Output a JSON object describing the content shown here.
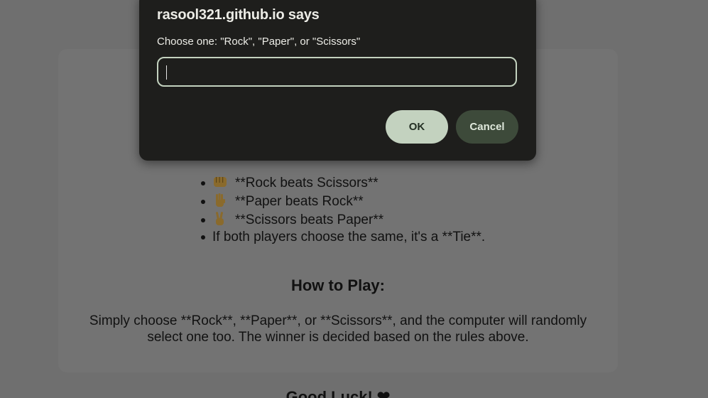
{
  "rules": {
    "items": [
      {
        "icon": "fist-icon",
        "text": "**Rock beats Scissors**"
      },
      {
        "icon": "raised-hand-icon",
        "text": "**Paper beats Rock**"
      },
      {
        "icon": "victory-hand-icon",
        "text": "**Scissors beats Paper**"
      },
      {
        "icon": "",
        "text": "If both players choose the same, it's a **Tie**."
      }
    ]
  },
  "how_to_play": {
    "title": "How to Play:",
    "text": "Simply choose **Rock**, **Paper**, or **Scissors**, and the computer will randomly select one too. The winner is decided based on the rules above."
  },
  "footer": {
    "partial_text": "Good Luck! ❤"
  },
  "dialog": {
    "title": "rasool321.github.io says",
    "message": "Choose one: \"Rock\", \"Paper\", or \"Scissors\"",
    "input_value": "",
    "ok_label": "OK",
    "cancel_label": "Cancel"
  },
  "colors": {
    "dialog_bg": "#1e1e1c",
    "ok_button": "#c3d2bf",
    "cancel_button": "#3d4a3a",
    "page_overlay": "#6f6f6f"
  }
}
